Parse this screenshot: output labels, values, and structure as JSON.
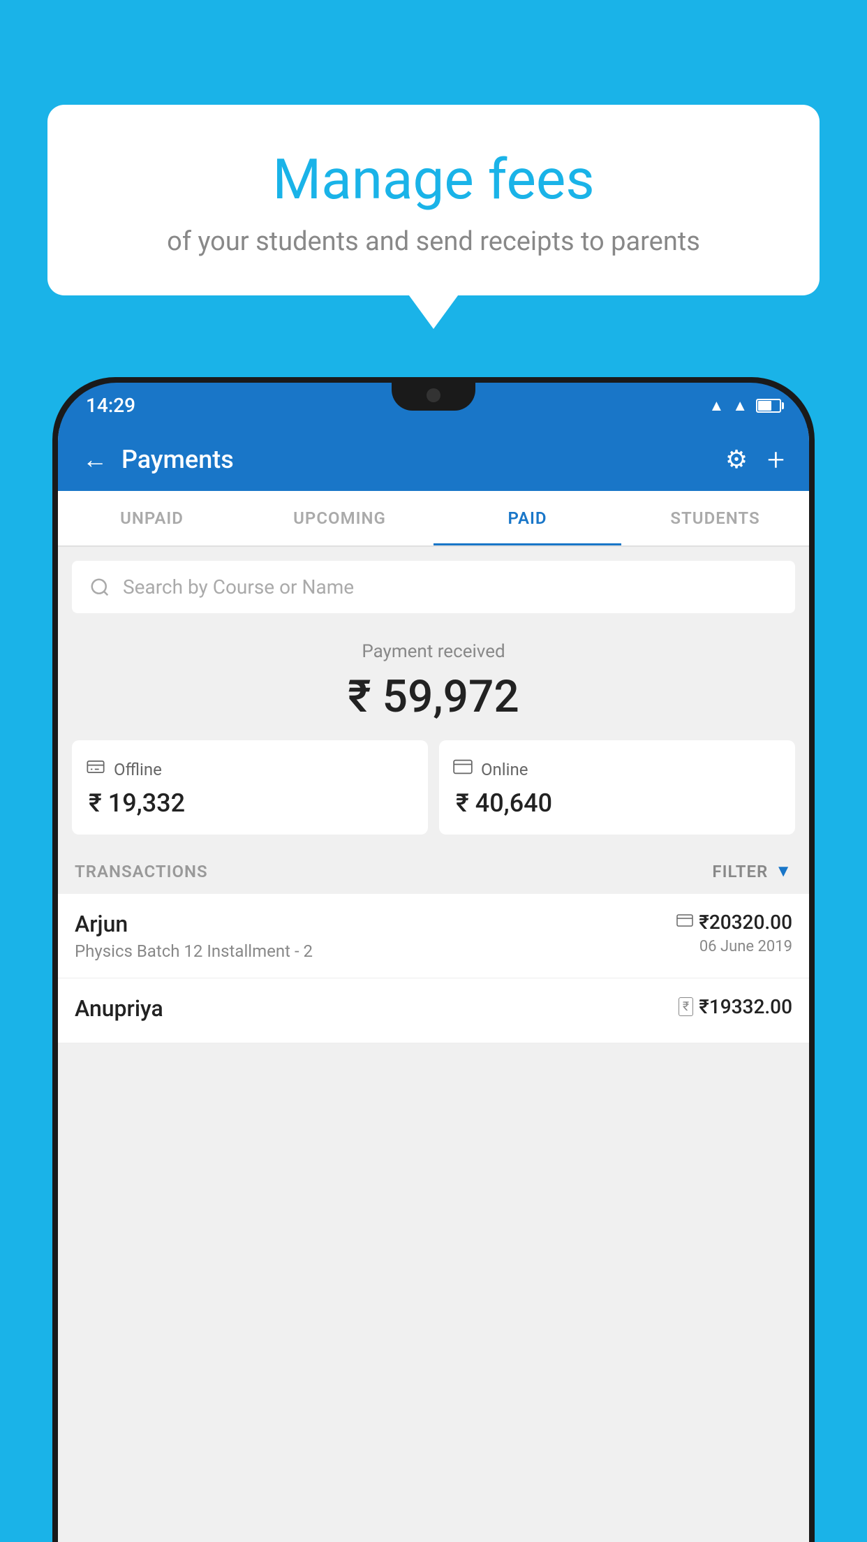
{
  "background_color": "#1ab3e8",
  "speech_bubble": {
    "title": "Manage fees",
    "subtitle": "of your students and send receipts to parents"
  },
  "status_bar": {
    "time": "14:29"
  },
  "header": {
    "title": "Payments",
    "back_label": "←",
    "settings_label": "⚙",
    "add_label": "+"
  },
  "tabs": [
    {
      "label": "UNPAID",
      "active": false
    },
    {
      "label": "UPCOMING",
      "active": false
    },
    {
      "label": "PAID",
      "active": true
    },
    {
      "label": "STUDENTS",
      "active": false
    }
  ],
  "search": {
    "placeholder": "Search by Course or Name"
  },
  "payment_summary": {
    "label": "Payment received",
    "amount": "₹ 59,972",
    "offline_label": "Offline",
    "offline_amount": "₹ 19,332",
    "online_label": "Online",
    "online_amount": "₹ 40,640"
  },
  "transactions": {
    "section_label": "TRANSACTIONS",
    "filter_label": "FILTER",
    "rows": [
      {
        "name": "Arjun",
        "course": "Physics Batch 12 Installment - 2",
        "amount": "₹20320.00",
        "date": "06 June 2019",
        "payment_type": "card"
      },
      {
        "name": "Anupriya",
        "course": "",
        "amount": "₹19332.00",
        "date": "",
        "payment_type": "cash"
      }
    ]
  }
}
